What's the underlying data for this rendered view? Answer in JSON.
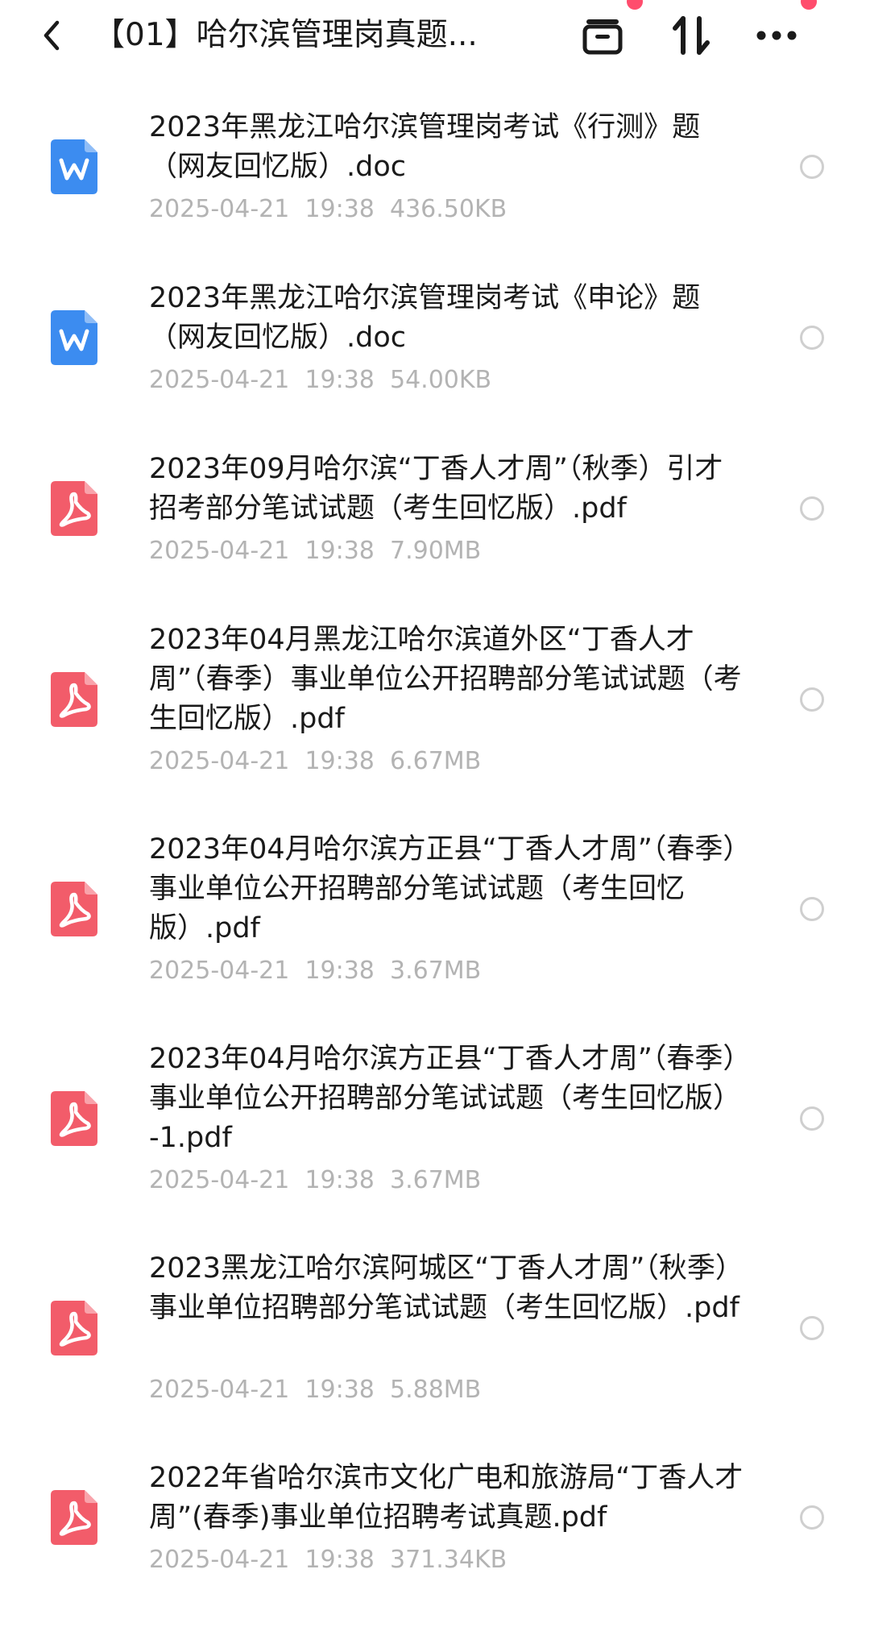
{
  "header": {
    "title": "【01】哈尔滨管理岗真题...",
    "back_icon": "chevron-left-icon",
    "icons": [
      "archive-icon",
      "sort-icon",
      "more-icon"
    ]
  },
  "colors": {
    "doc_icon": "#3c8cf0",
    "pdf_icon": "#f25c6a",
    "badge": "#ff4d6d",
    "meta_text": "#b3b3b3"
  },
  "files": [
    {
      "type": "doc",
      "name": "2023年黑龙江哈尔滨管理岗考试《行测》题（网友回忆版）.doc",
      "date": "2025-04-21",
      "time": "19:38",
      "size": "436.50KB"
    },
    {
      "type": "doc",
      "name": "2023年黑龙江哈尔滨管理岗考试《申论》题（网友回忆版）.doc",
      "date": "2025-04-21",
      "time": "19:38",
      "size": "54.00KB"
    },
    {
      "type": "pdf",
      "name": "2023年09月哈尔滨“丁香人才周”（秋季）引才招考部分笔试试题（考生回忆版）.pdf",
      "date": "2025-04-21",
      "time": "19:38",
      "size": "7.90MB"
    },
    {
      "type": "pdf",
      "name": "2023年04月黑龙江哈尔滨道外区“丁香人才周”（春季）事业单位公开招聘部分笔试试题（考生回忆版）.pdf",
      "date": "2025-04-21",
      "time": "19:38",
      "size": "6.67MB"
    },
    {
      "type": "pdf",
      "name": "2023年04月哈尔滨方正县“丁香人才周”（春季）事业单位公开招聘部分笔试试题（考生回忆版）.pdf",
      "date": "2025-04-21",
      "time": "19:38",
      "size": "3.67MB"
    },
    {
      "type": "pdf",
      "name": "2023年04月哈尔滨方正县“丁香人才周”（春季）事业单位公开招聘部分笔试试题（考生回忆版）-1.pdf",
      "date": "2025-04-21",
      "time": "19:38",
      "size": "3.67MB"
    },
    {
      "type": "pdf",
      "name": "2023黑龙江哈尔滨阿城区“丁香人才周”（秋季）事业单位招聘部分笔试试题（考生回忆版）.pdf",
      "date": "2025-04-21",
      "time": "19:38",
      "size": "5.88MB"
    },
    {
      "type": "pdf",
      "name": "2022年省哈尔滨市文化广电和旅游局“丁香人才周”(春季)事业单位招聘考试真题.pdf",
      "date": "2025-04-21",
      "time": "19:38",
      "size": "371.34KB"
    }
  ]
}
